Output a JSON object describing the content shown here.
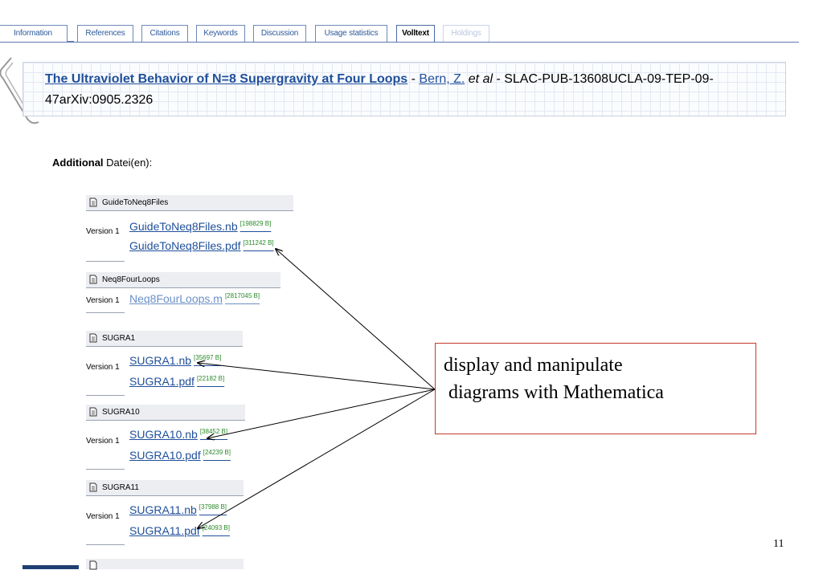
{
  "tabs": [
    {
      "label": "Information",
      "state": "normal"
    },
    {
      "label": "References",
      "state": "normal"
    },
    {
      "label": "Citations",
      "state": "normal"
    },
    {
      "label": "Keywords",
      "state": "normal"
    },
    {
      "label": "Discussion",
      "state": "normal"
    },
    {
      "label": "Usage statistics",
      "state": "normal"
    },
    {
      "label": "Volltext",
      "state": "active"
    },
    {
      "label": "Holdings",
      "state": "disabled"
    }
  ],
  "record": {
    "title": "The Ultraviolet Behavior of N=8 Supergravity at Four Loops",
    "sep1": " - ",
    "author": "Bern, Z.",
    "etal": " et al",
    "rest": " - SLAC-PUB-13608UCLA-09-TEP-09-47arXiv:0905.2326"
  },
  "additional": {
    "bold": "Additional",
    "rest": " Datei(en):"
  },
  "groups": [
    {
      "name": "GuideToNeq8Files",
      "version": "Version 1",
      "files": [
        {
          "name": "GuideToNeq8Files.nb",
          "size": "[198829 B]"
        },
        {
          "name": "GuideToNeq8Files.pdf",
          "size": "[311242 B]"
        }
      ]
    },
    {
      "name": "Neq8FourLoops",
      "version": "Version 1",
      "files": [
        {
          "name": "Neq8FourLoops.m",
          "size": "[2817045 B]"
        }
      ]
    },
    {
      "name": "SUGRA1",
      "version": "Version 1",
      "files": [
        {
          "name": "SUGRA1.nb",
          "size": "[35697 B]"
        },
        {
          "name": "SUGRA1.pdf",
          "size": "[22182 B]"
        }
      ]
    },
    {
      "name": "SUGRA10",
      "version": "Version 1",
      "files": [
        {
          "name": "SUGRA10.nb",
          "size": "[38452 B]"
        },
        {
          "name": "SUGRA10.pdf",
          "size": "[24239 B]"
        }
      ]
    },
    {
      "name": "SUGRA11",
      "version": "Version 1",
      "files": [
        {
          "name": "SUGRA11.nb",
          "size": "[37988 B]"
        },
        {
          "name": "SUGRA11.pdf",
          "size": "[24093 B]"
        }
      ]
    }
  ],
  "annotation": {
    "line1": "display and manipulate",
    "line2": " diagrams with Mathematica"
  },
  "page_number": "11",
  "colors": {
    "link": "#1f4f9a",
    "size": "#2a8a2a",
    "annot_border": "#c0392b",
    "tab_border": "#6f89b8"
  }
}
